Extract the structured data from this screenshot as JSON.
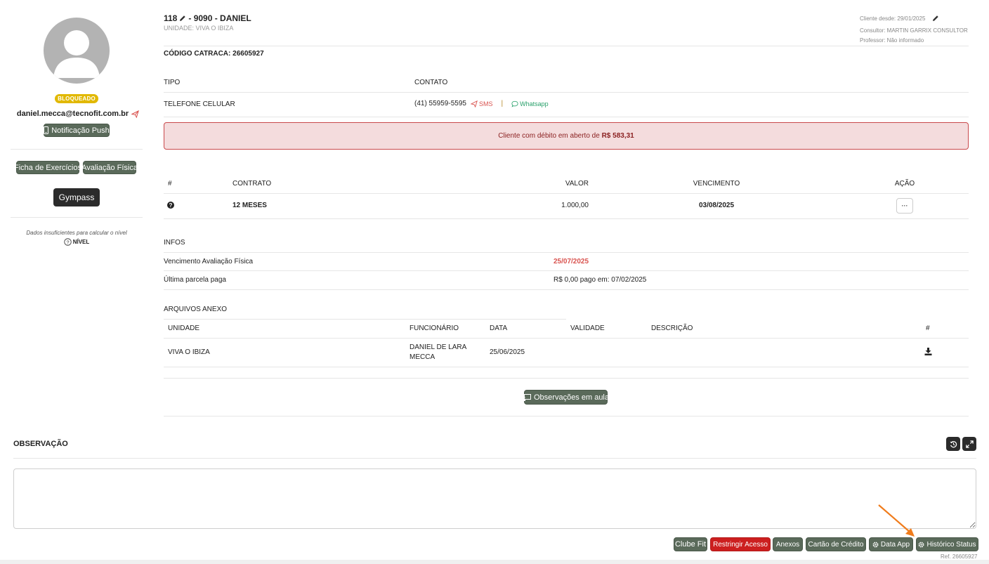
{
  "profile": {
    "status_badge": "BLOQUEADO",
    "email": "daniel.mecca@tecnofit.com.br",
    "push_button": "Notificação Push",
    "workout_button": "Ficha de Exercícios",
    "assessment_button": "Avaliação Física",
    "gympass_button": "Gympass",
    "level_message": "Dados insuficientes para calcular o nível",
    "level_label": "NÍVEL"
  },
  "header": {
    "id_prefix": "118",
    "id_suffix": "- 9090 - DANIEL",
    "unit": "UNIDADE: VIVA O IBIZA",
    "client_since": "Cliente desde: 29/01/2025",
    "consultant": "Consultor: MARTIN GARRIX CONSULTOR",
    "teacher": "Professor: Não informado",
    "turnstile_code": "CÓDIGO CATRACA: 26605927"
  },
  "contact": {
    "col_type": "TIPO",
    "col_contact": "CONTATO",
    "type": "TELEFONE CELULAR",
    "phone": "(41) 55959-5595",
    "sms": "SMS",
    "separator": "|",
    "whatsapp": "Whatsapp"
  },
  "debt_alert": {
    "text": "Cliente com débito em aberto de ",
    "amount": "R$ 583,31"
  },
  "contracts": {
    "headers": [
      "#",
      "CONTRATO",
      "VALOR",
      "VENCIMENTO",
      "AÇÃO"
    ],
    "rows": [
      {
        "name": "12 MESES",
        "value": "1.000,00",
        "due": "03/08/2025",
        "action": "···"
      }
    ]
  },
  "infos": {
    "title": "INFOS",
    "assessment_label": "Vencimento Avaliação Física",
    "assessment_value": "25/07/2025",
    "last_payment_label": "Última parcela paga",
    "last_payment_value": "R$ 0,00 pago em: 07/02/2025"
  },
  "attachments": {
    "title": "ARQUIVOS ANEXO",
    "headers": [
      "UNIDADE",
      "FUNCIONÁRIO",
      "DATA",
      "VALIDADE",
      "DESCRIÇÃO",
      "#"
    ],
    "rows": [
      {
        "unit": "VIVA O IBIZA",
        "employee_line1": "DANIEL DE LARA",
        "employee_line2": "MECCA",
        "date": "25/06/2025",
        "validity": "",
        "description": ""
      }
    ],
    "class_notes_button": "Observações em aula"
  },
  "observation": {
    "title": "OBSERVAÇÃO",
    "value": ""
  },
  "footer": {
    "clube_fit": "Clube Fit",
    "restrict_access": "Restringir Acesso",
    "attachments": "Anexos",
    "credit_card": "Cartão de Crédito",
    "data_app": "Data App",
    "status_history": "Histórico Status",
    "ref": "Ref. 26605927"
  },
  "colors": {
    "accent_gray": "#5a6a5a",
    "badge_yellow": "#e1b800",
    "danger": "#cc1f1f",
    "debt_bg": "#f4dcdd",
    "arrow_orange": "#f07c1c"
  }
}
